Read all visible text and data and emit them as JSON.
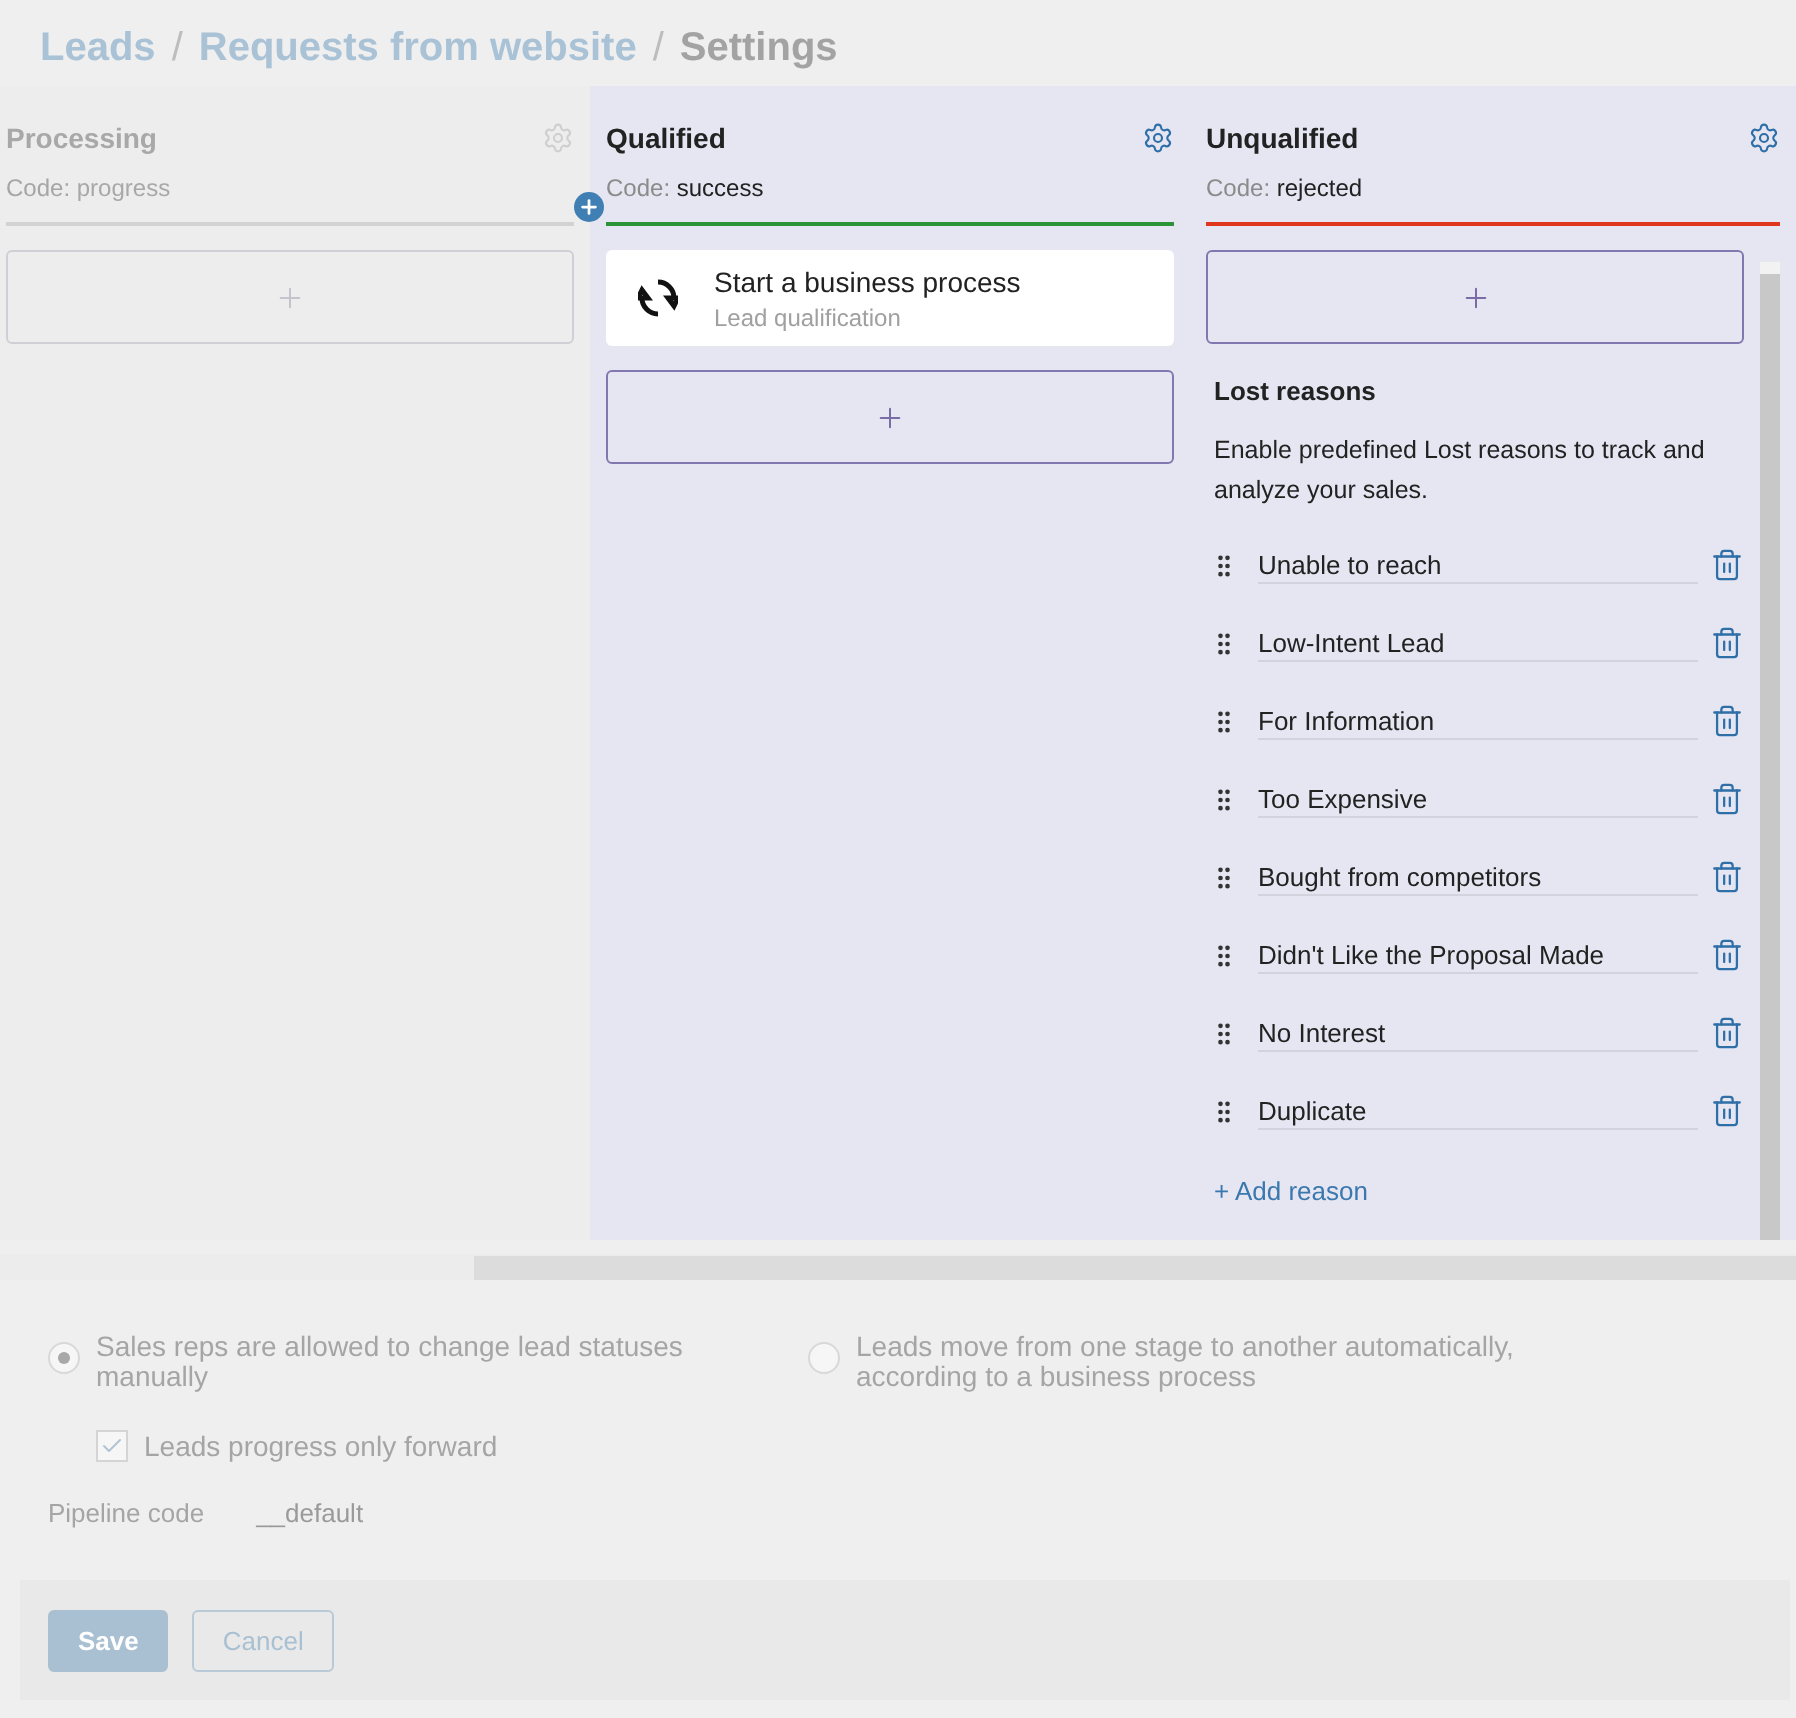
{
  "breadcrumb_separator": "/",
  "breadcrumb": [
    {
      "label": "Leads",
      "kind": "link"
    },
    {
      "label": "Requests from website",
      "kind": "link"
    },
    {
      "label": "Settings",
      "kind": "current"
    }
  ],
  "columns": [
    {
      "title": "Processing",
      "code_label": "Code:",
      "code": "progress",
      "color": "#d2d2d2",
      "disabled": true
    },
    {
      "title": "Qualified",
      "code_label": "Code:",
      "code": "success",
      "color": "#2b9436",
      "disabled": false,
      "cards": [
        {
          "title": "Start a business process",
          "subtitle": "Lead qualification"
        }
      ]
    },
    {
      "title": "Unqualified",
      "code_label": "Code:",
      "code": "rejected",
      "color": "#e0361e",
      "disabled": false,
      "lost_reasons": {
        "title": "Lost reasons",
        "description": "Enable predefined Lost reasons to track and analyze your sales.",
        "items": [
          "Unable to reach",
          "Low-Intent Lead",
          "For Information",
          "Too Expensive",
          "Bought from competitors",
          "Didn't Like the Proposal Made",
          "No Interest",
          "Duplicate"
        ],
        "add_label": "+ Add reason"
      }
    }
  ],
  "options": {
    "radios": [
      {
        "label": "Sales reps are allowed to change lead statuses manually",
        "selected": true
      },
      {
        "label": "Leads move from one stage to another automatically, according to a business process",
        "selected": false
      }
    ],
    "checkbox": {
      "label": "Leads progress only forward",
      "checked": true
    },
    "pipeline": {
      "label": "Pipeline code",
      "value": "__default"
    },
    "buttons": [
      {
        "label": "Save",
        "kind": "primary"
      },
      {
        "label": "Cancel",
        "kind": "secondary"
      }
    ]
  }
}
